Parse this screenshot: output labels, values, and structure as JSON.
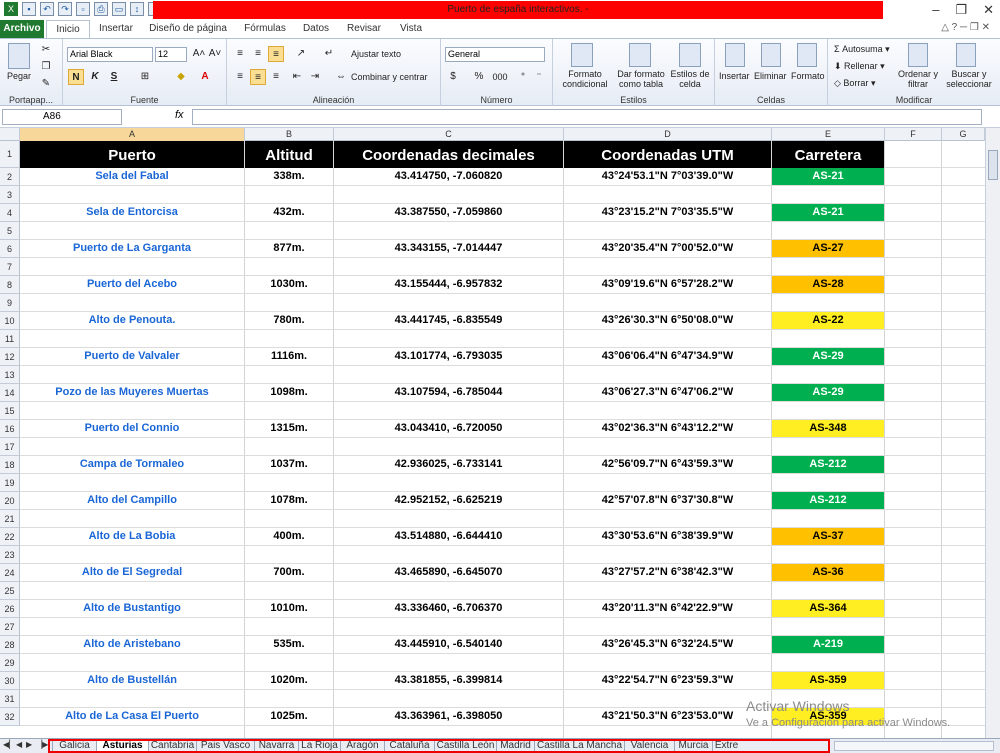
{
  "window": {
    "title": "Puerto de españa interactivos. -"
  },
  "ribbon": {
    "tabs": [
      "Archivo",
      "Inicio",
      "Insertar",
      "Diseño de página",
      "Fórmulas",
      "Datos",
      "Revisar",
      "Vista"
    ],
    "groups": {
      "portapapeles": {
        "name": "Portapap...",
        "paste": "Pegar"
      },
      "fuente": {
        "name": "Fuente",
        "font": "Arial Black",
        "size": "12",
        "bold": "N",
        "italic": "K",
        "underline": "S"
      },
      "alineacion": {
        "name": "Alineación",
        "wrap": "Ajustar texto",
        "merge": "Combinar y centrar"
      },
      "numero": {
        "name": "Número",
        "format": "General",
        "percent": "%",
        "thousands": "000"
      },
      "estilos": {
        "name": "Estilos",
        "conditional": "Formato condicional",
        "table": "Dar formato como tabla",
        "cell_styles": "Estilos de celda"
      },
      "celdas": {
        "name": "Celdas",
        "insert": "Insertar",
        "delete": "Eliminar",
        "format": "Formato"
      },
      "modificar": {
        "name": "Modificar",
        "autosum": "Autosuma",
        "fill": "Rellenar",
        "clear": "Borrar",
        "sort": "Ordenar y filtrar",
        "find": "Buscar y seleccionar"
      }
    }
  },
  "formula_bar": {
    "name_box": "A86",
    "fx": "fx",
    "value": ""
  },
  "columns": [
    "A",
    "B",
    "C",
    "D",
    "E",
    "F",
    "G"
  ],
  "rows": [
    "1",
    "2",
    "3",
    "4",
    "5",
    "6",
    "7",
    "8",
    "9",
    "10",
    "11",
    "12",
    "13",
    "14",
    "15",
    "16",
    "17",
    "18",
    "19",
    "20",
    "21",
    "22",
    "23",
    "24",
    "25",
    "26",
    "27",
    "28",
    "29",
    "30",
    "31",
    "32"
  ],
  "table": {
    "headers": {
      "puerto": "Puerto",
      "altitud": "Altitud",
      "decimales": "Coordenadas decimales",
      "utm": "Coordenadas UTM",
      "carretera": "Carretera"
    },
    "rows": [
      {
        "puerto": "Sela del Fabal",
        "altitud": "338m.",
        "decimales": "43.414750, -7.060820",
        "utm": "43°24'53.1\"N 7°03'39.0\"W",
        "carretera": "AS-21",
        "color": "#00b050"
      },
      {
        "puerto": "Sela de Entorcisa",
        "altitud": "432m.",
        "decimales": "43.387550, -7.059860",
        "utm": "43°23'15.2\"N 7°03'35.5\"W",
        "carretera": "AS-21",
        "color": "#00b050"
      },
      {
        "puerto": "Puerto de La Garganta",
        "altitud": "877m.",
        "decimales": "43.343155, -7.014447",
        "utm": "43°20'35.4\"N 7°00'52.0\"W",
        "carretera": "AS-27",
        "color": "#ffc000"
      },
      {
        "puerto": "Puerto del Acebo",
        "altitud": "1030m.",
        "decimales": "43.155444, -6.957832",
        "utm": "43°09'19.6\"N 6°57'28.2\"W",
        "carretera": "AS-28",
        "color": "#ffc000"
      },
      {
        "puerto": "Alto de Penouta.",
        "altitud": "780m.",
        "decimales": "43.441745, -6.835549",
        "utm": "43°26'30.3\"N 6°50'08.0\"W",
        "carretera": "AS-22",
        "color": "#ffee22"
      },
      {
        "puerto": "Puerto de Valvaler",
        "altitud": "1116m.",
        "decimales": "43.101774, -6.793035",
        "utm": "43°06'06.4\"N 6°47'34.9\"W",
        "carretera": "AS-29",
        "color": "#00b050"
      },
      {
        "puerto": "Pozo de las Muyeres Muertas",
        "altitud": "1098m.",
        "decimales": "43.107594, -6.785044",
        "utm": "43°06'27.3\"N 6°47'06.2\"W",
        "carretera": "AS-29",
        "color": "#00b050"
      },
      {
        "puerto": "Puerto del Connio",
        "altitud": "1315m.",
        "decimales": "43.043410, -6.720050",
        "utm": "43°02'36.3\"N 6°43'12.2\"W",
        "carretera": "AS-348",
        "color": "#ffee22"
      },
      {
        "puerto": "Campa de Tormaleo",
        "altitud": "1037m.",
        "decimales": "42.936025, -6.733141",
        "utm": "42°56'09.7\"N 6°43'59.3\"W",
        "carretera": "AS-212",
        "color": "#00b050"
      },
      {
        "puerto": "Alto del Campillo",
        "altitud": "1078m.",
        "decimales": "42.952152, -6.625219",
        "utm": "42°57'07.8\"N 6°37'30.8\"W",
        "carretera": "AS-212",
        "color": "#00b050"
      },
      {
        "puerto": "Alto de La Bobia",
        "altitud": "400m.",
        "decimales": "43.514880, -6.644410",
        "utm": "43°30'53.6\"N 6°38'39.9\"W",
        "carretera": "AS-37",
        "color": "#ffc000"
      },
      {
        "puerto": "Alto de El Segredal",
        "altitud": "700m.",
        "decimales": "43.465890, -6.645070",
        "utm": "43°27'57.2\"N 6°38'42.3\"W",
        "carretera": "AS-36",
        "color": "#ffc000"
      },
      {
        "puerto": "Alto de Bustantigo",
        "altitud": "1010m.",
        "decimales": "43.336460, -6.706370",
        "utm": "43°20'11.3\"N 6°42'22.9\"W",
        "carretera": "AS-364",
        "color": "#ffee22"
      },
      {
        "puerto": "Alto de Aristebano",
        "altitud": "535m.",
        "decimales": "43.445910, -6.540140",
        "utm": "43°26'45.3\"N 6°32'24.5\"W",
        "carretera": "A-219",
        "color": "#00b050"
      },
      {
        "puerto": "Alto de Bustellán",
        "altitud": "1020m.",
        "decimales": "43.381855, -6.399814",
        "utm": "43°22'54.7\"N 6°23'59.3\"W",
        "carretera": "AS-359",
        "color": "#ffee22"
      },
      {
        "puerto": "Alto de La Casa El Puerto",
        "altitud": "1025m.",
        "decimales": "43.363961, -6.398050",
        "utm": "43°21'50.3\"N 6°23'53.0\"W",
        "carretera": "AS-359",
        "color": "#ffee22"
      }
    ]
  },
  "sheets": [
    "Galicia",
    "Asturias",
    "Cantabria",
    "Pais Vasco",
    "Navarra",
    "La Rioja",
    "Aragón",
    "Cataluña",
    "Castilla León",
    "Madrid",
    "Castilla La Mancha",
    "Valencia",
    "Murcia",
    "Extre"
  ],
  "active_sheet": "Asturias",
  "watermark": {
    "line1": "Activar Windows",
    "line2": "Ve a Configuración para activar Windows."
  }
}
